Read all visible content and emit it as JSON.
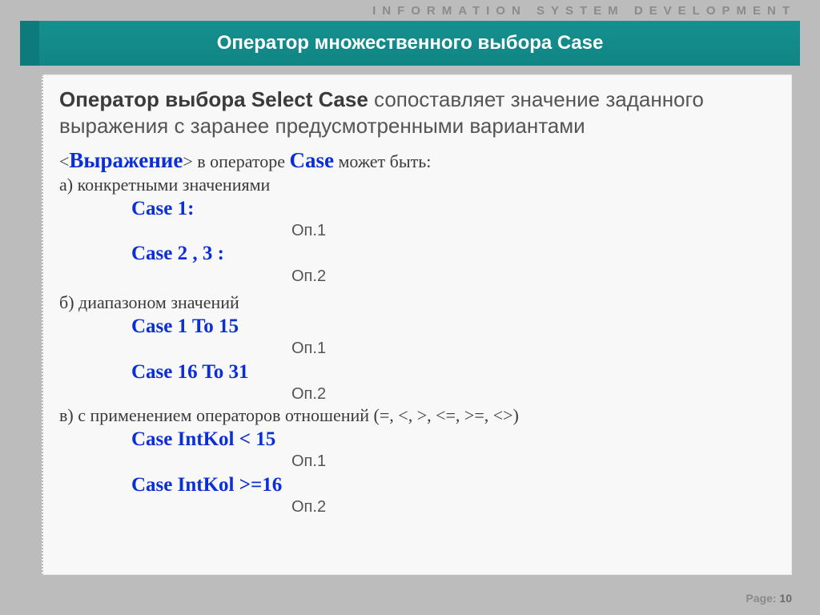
{
  "header": {
    "overline": "INFORMATION SYSTEM DEVELOPMENT",
    "title": "Оператор множественного выбора Case"
  },
  "lead": {
    "strong": "Оператор выбора Select Case",
    "rest": " сопоставляет значение заданного выражения с заранее предусмотренными вариантами"
  },
  "intro": {
    "lt": "<",
    "expr": "Выражение",
    "gt": ">",
    "mid": " в операторе ",
    "casekw": "Case",
    "tail": " может быть:"
  },
  "sections": {
    "a_label": "а) конкретными значениями",
    "a_case1": "Case 1:",
    "a_op1": "Оп.1",
    "a_case2": "Case 2 , 3 :",
    "a_op2": "Оп.2",
    "b_label": "б) диапазоном значений",
    "b_case1": "Case 1 To 15",
    "b_op1": "Оп.1",
    "b_case2": "Case 16 To 31",
    "b_op2": "Оп.2",
    "c_label": "в) с применением операторов отношений (=, <, >, <=, >=, <>)",
    "c_case1": "Case IntKol < 15",
    "c_op1": "Оп.1",
    "c_case2": "Case IntKol >=16",
    "c_op2": "Оп.2"
  },
  "footer": {
    "page_label": "Page: ",
    "page_num": "10"
  }
}
